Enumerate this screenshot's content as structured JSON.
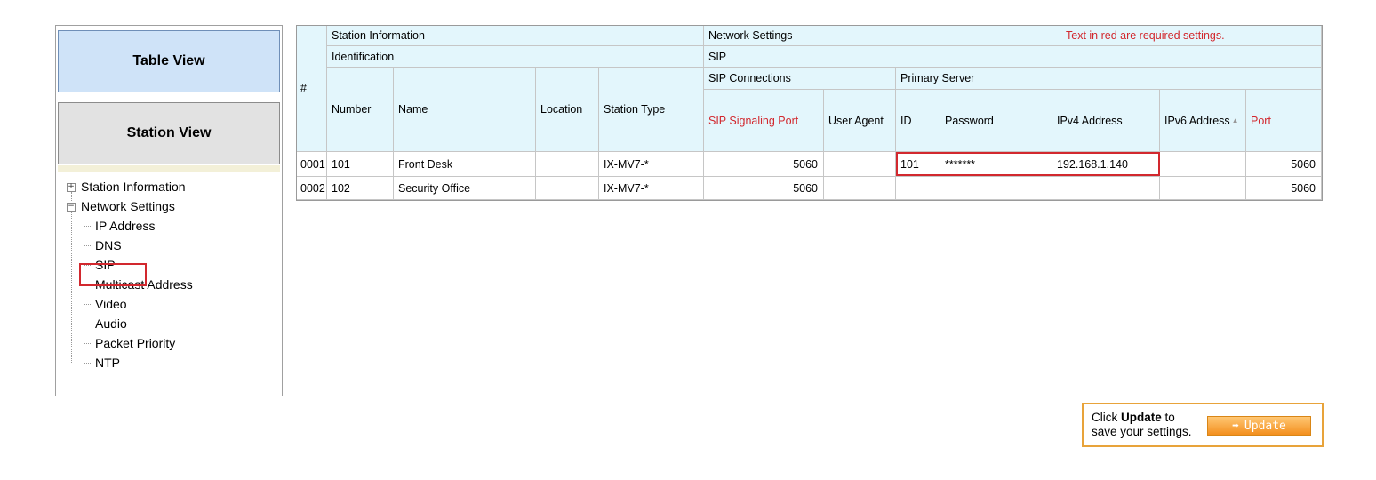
{
  "left_panel": {
    "table_view_label": "Table View",
    "station_view_label": "Station View",
    "tree": {
      "station_information": "Station Information",
      "network_settings": "Network Settings",
      "children": [
        "IP Address",
        "DNS",
        "SIP",
        "Multicast Address",
        "Video",
        "Audio",
        "Packet Priority",
        "NTP"
      ]
    }
  },
  "grid": {
    "hash_header": "#",
    "group1": "Station Information",
    "group1_sub": "Identification",
    "group2": "Network Settings",
    "group2_sub": "SIP",
    "sip_connections": "SIP Connections",
    "primary_server": "Primary Server",
    "required_note": "Text in red are required settings.",
    "columns": {
      "number": "Number",
      "name": "Name",
      "location": "Location",
      "station_type": "Station Type",
      "sip_port": "SIP Signaling Port",
      "user_agent": "User Agent",
      "id": "ID",
      "password": "Password",
      "ipv4": "IPv4 Address",
      "ipv6": "IPv6 Address",
      "port": "Port"
    },
    "rows": [
      {
        "index": "0001",
        "number": "101",
        "name": "Front Desk",
        "location": "",
        "station_type": "IX-MV7-*",
        "sip_port": "5060",
        "user_agent": "",
        "id": "101",
        "password": "*******",
        "ipv4": "192.168.1.140",
        "ipv6": "",
        "port": "5060"
      },
      {
        "index": "0002",
        "number": "102",
        "name": "Security Office",
        "location": "",
        "station_type": "IX-MV7-*",
        "sip_port": "5060",
        "user_agent": "",
        "id": "",
        "password": "",
        "ipv4": "",
        "ipv6": "",
        "port": "5060"
      }
    ]
  },
  "update_box": {
    "text_pre": "Click ",
    "text_bold": "Update",
    "text_post": " to",
    "text_line2": "save your settings.",
    "button_label": "Update",
    "button_arrow": "➡"
  }
}
